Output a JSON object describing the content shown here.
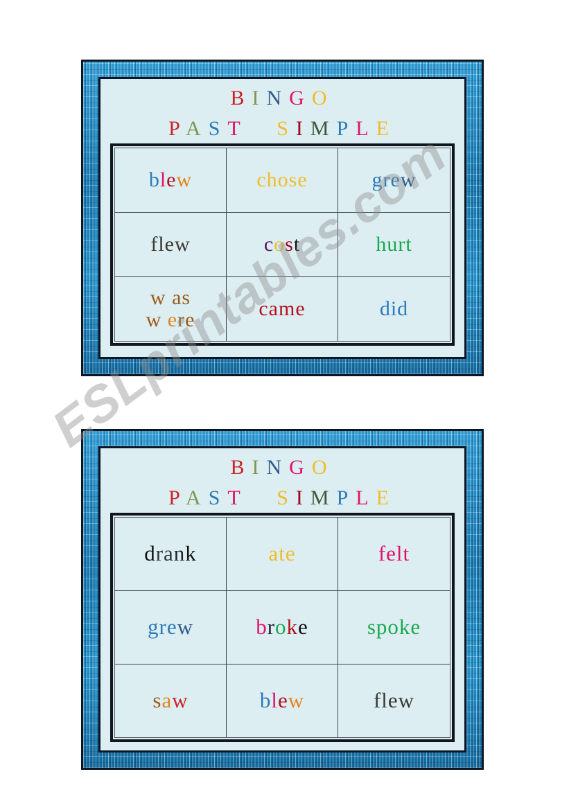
{
  "watermark": {
    "text": "ESLprintables.com"
  },
  "palette": {
    "card_background": "#ddeef2",
    "frame_blue": "#1b86be",
    "frame_outline": "#0d1625",
    "grid_border": "#11151c",
    "red": "#cc2229",
    "olive": "#7f964e",
    "slate_blue": "#2f5b8a",
    "pink": "#e0136c",
    "gold": "#f0bc2a",
    "steel_blue": "#2b7bb9",
    "dark_red": "#9e0020",
    "dark_green": "#1f5b2e",
    "green": "#1aa84f",
    "orange": "#e2841f",
    "brown": "#9a5b18",
    "purple": "#57196a",
    "black": "#111111",
    "dark_gray": "#3a3a33",
    "navy": "#1b2230"
  },
  "cards": [
    {
      "id": "card-1",
      "title_bingo": {
        "letters": [
          {
            "char": "B",
            "color": "#cc2229"
          },
          {
            "char": "I",
            "color": "#7f964e"
          },
          {
            "char": "N",
            "color": "#2f5b8a"
          },
          {
            "char": "G",
            "color": "#e0136c"
          },
          {
            "char": "O",
            "color": "#f0bc2a"
          }
        ]
      },
      "title_past_simple": {
        "word1": [
          {
            "char": "P",
            "color": "#cc2229"
          },
          {
            "char": "A",
            "color": "#7f964e"
          },
          {
            "char": "S",
            "color": "#2b7bb9"
          },
          {
            "char": "T",
            "color": "#e0136c"
          }
        ],
        "word2": [
          {
            "char": "S",
            "color": "#f0bc2a"
          },
          {
            "char": "I",
            "color": "#9e0020"
          },
          {
            "char": "M",
            "color": "#3c5a36"
          },
          {
            "char": "P",
            "color": "#2b7bb9"
          },
          {
            "char": "L",
            "color": "#e0136c"
          },
          {
            "char": "E",
            "color": "#f0bc2a"
          }
        ]
      },
      "rows": [
        [
          {
            "label": "blew",
            "lines": [
              [
                {
                  "char": "b",
                  "color": "#2b7bb9"
                },
                {
                  "char": "l",
                  "color": "#e0136c"
                },
                {
                  "char": "e",
                  "color": "#b3131f"
                },
                {
                  "char": "w",
                  "color": "#e2841f"
                }
              ]
            ]
          },
          {
            "label": "chose",
            "lines": [
              [
                {
                  "char": "c",
                  "color": "#f0bc2a"
                },
                {
                  "char": "h",
                  "color": "#f0bc2a"
                },
                {
                  "char": "o",
                  "color": "#f0bc2a"
                },
                {
                  "char": "s",
                  "color": "#f0bc2a"
                },
                {
                  "char": "e",
                  "color": "#f0bc2a"
                }
              ]
            ]
          },
          {
            "label": "grew",
            "lines": [
              [
                {
                  "char": "g",
                  "color": "#2b7bb9"
                },
                {
                  "char": "r",
                  "color": "#2b7bb9"
                },
                {
                  "char": "e",
                  "color": "#2b7bb9"
                },
                {
                  "char": "w",
                  "color": "#2f5b8a"
                }
              ]
            ]
          }
        ],
        [
          {
            "label": "flew",
            "lines": [
              [
                {
                  "char": "f",
                  "color": "#3a3a33"
                },
                {
                  "char": "l",
                  "color": "#3a3a33"
                },
                {
                  "char": "e",
                  "color": "#3a3a33"
                },
                {
                  "char": "w",
                  "color": "#3a3a33"
                }
              ]
            ]
          },
          {
            "label": "cost",
            "lines": [
              [
                {
                  "char": "c",
                  "color": "#57196a"
                },
                {
                  "char": "o",
                  "color": "#f0bc2a"
                },
                {
                  "char": "s",
                  "color": "#9e0020"
                },
                {
                  "char": "t",
                  "color": "#111111"
                }
              ]
            ]
          },
          {
            "label": "hurt",
            "lines": [
              [
                {
                  "char": "h",
                  "color": "#1aa84f"
                },
                {
                  "char": "u",
                  "color": "#1aa84f"
                },
                {
                  "char": "r",
                  "color": "#1aa84f"
                },
                {
                  "char": "t",
                  "color": "#1aa84f"
                }
              ]
            ]
          }
        ],
        [
          {
            "label": "was were",
            "lines": [
              [
                {
                  "char": "w",
                  "color": "#9a5b18"
                },
                {
                  "char": " ",
                  "color": "#9a5b18"
                },
                {
                  "char": "a",
                  "color": "#9a5b18"
                },
                {
                  "char": "s",
                  "color": "#9a5b18"
                }
              ],
              [
                {
                  "char": "w",
                  "color": "#9a5b18"
                },
                {
                  "char": " ",
                  "color": "#9a5b18"
                },
                {
                  "char": "e",
                  "color": "#e2841f"
                },
                {
                  "char": "r",
                  "color": "#9a5b18"
                },
                {
                  "char": "e",
                  "color": "#9a5b18"
                }
              ]
            ]
          },
          {
            "label": "came",
            "lines": [
              [
                {
                  "char": "c",
                  "color": "#b3131f"
                },
                {
                  "char": "a",
                  "color": "#b3131f"
                },
                {
                  "char": "m",
                  "color": "#b3131f"
                },
                {
                  "char": "e",
                  "color": "#b3131f"
                }
              ]
            ]
          },
          {
            "label": "did",
            "lines": [
              [
                {
                  "char": "d",
                  "color": "#2b7bb9"
                },
                {
                  "char": "i",
                  "color": "#2b7bb9"
                },
                {
                  "char": "d",
                  "color": "#2b7bb9"
                }
              ]
            ]
          }
        ]
      ]
    },
    {
      "id": "card-2",
      "title_bingo": {
        "letters": [
          {
            "char": "B",
            "color": "#cc2229"
          },
          {
            "char": "I",
            "color": "#7f964e"
          },
          {
            "char": "N",
            "color": "#2f5b8a"
          },
          {
            "char": "G",
            "color": "#e0136c"
          },
          {
            "char": "O",
            "color": "#f0bc2a"
          }
        ]
      },
      "title_past_simple": {
        "word1": [
          {
            "char": "P",
            "color": "#cc2229"
          },
          {
            "char": "A",
            "color": "#7f964e"
          },
          {
            "char": "S",
            "color": "#2b7bb9"
          },
          {
            "char": "T",
            "color": "#e0136c"
          }
        ],
        "word2": [
          {
            "char": "S",
            "color": "#f0bc2a"
          },
          {
            "char": "I",
            "color": "#9e0020"
          },
          {
            "char": "M",
            "color": "#3c5a36"
          },
          {
            "char": "P",
            "color": "#2b7bb9"
          },
          {
            "char": "L",
            "color": "#e0136c"
          },
          {
            "char": "E",
            "color": "#f0bc2a"
          }
        ]
      },
      "rows": [
        [
          {
            "label": "drank",
            "lines": [
              [
                {
                  "char": "d",
                  "color": "#111111"
                },
                {
                  "char": "r",
                  "color": "#2e3440"
                },
                {
                  "char": "a",
                  "color": "#2e3440"
                },
                {
                  "char": "n",
                  "color": "#1b2230"
                },
                {
                  "char": "k",
                  "color": "#111111"
                }
              ]
            ]
          },
          {
            "label": "ate",
            "lines": [
              [
                {
                  "char": "a",
                  "color": "#f0bc2a"
                },
                {
                  "char": "t",
                  "color": "#f0bc2a"
                },
                {
                  "char": "e",
                  "color": "#f0bc2a"
                }
              ]
            ]
          },
          {
            "label": "felt",
            "lines": [
              [
                {
                  "char": "f",
                  "color": "#e0136c"
                },
                {
                  "char": "e",
                  "color": "#e0136c"
                },
                {
                  "char": "l",
                  "color": "#e0136c"
                },
                {
                  "char": "t",
                  "color": "#e0136c"
                }
              ]
            ]
          }
        ],
        [
          {
            "label": "grew",
            "lines": [
              [
                {
                  "char": "g",
                  "color": "#2b7bb9"
                },
                {
                  "char": "r",
                  "color": "#2b7bb9"
                },
                {
                  "char": "e",
                  "color": "#2b7bb9"
                },
                {
                  "char": "w",
                  "color": "#2f5b8a"
                }
              ]
            ]
          },
          {
            "label": "broke",
            "lines": [
              [
                {
                  "char": "b",
                  "color": "#e0136c"
                },
                {
                  "char": "r",
                  "color": "#1b2230"
                },
                {
                  "char": "o",
                  "color": "#1aa84f"
                },
                {
                  "char": "k",
                  "color": "#b3131f"
                },
                {
                  "char": "e",
                  "color": "#111111"
                }
              ]
            ]
          },
          {
            "label": "spoke",
            "lines": [
              [
                {
                  "char": "s",
                  "color": "#1aa84f"
                },
                {
                  "char": "p",
                  "color": "#1aa84f"
                },
                {
                  "char": "o",
                  "color": "#1aa84f"
                },
                {
                  "char": "k",
                  "color": "#1aa84f"
                },
                {
                  "char": "e",
                  "color": "#1aa84f"
                }
              ]
            ]
          }
        ],
        [
          {
            "label": "saw",
            "lines": [
              [
                {
                  "char": "s",
                  "color": "#9a5b18"
                },
                {
                  "char": "a",
                  "color": "#e2841f"
                },
                {
                  "char": "w",
                  "color": "#cc2229"
                }
              ]
            ]
          },
          {
            "label": "blew",
            "lines": [
              [
                {
                  "char": "b",
                  "color": "#2b7bb9"
                },
                {
                  "char": "l",
                  "color": "#e0136c"
                },
                {
                  "char": "e",
                  "color": "#b3131f"
                },
                {
                  "char": "w",
                  "color": "#e2841f"
                }
              ]
            ]
          },
          {
            "label": "flew",
            "lines": [
              [
                {
                  "char": "f",
                  "color": "#3a3a33"
                },
                {
                  "char": "l",
                  "color": "#3a3a33"
                },
                {
                  "char": "e",
                  "color": "#3a3a33"
                },
                {
                  "char": "w",
                  "color": "#3a3a33"
                }
              ]
            ]
          }
        ]
      ]
    }
  ]
}
